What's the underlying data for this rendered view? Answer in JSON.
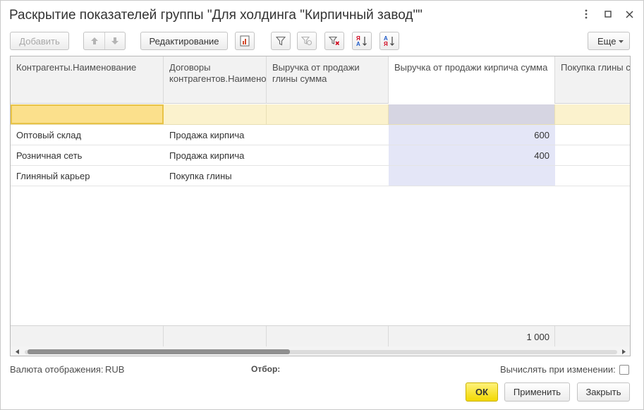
{
  "window": {
    "title": "Раскрытие показателей группы \"Для холдинга \"Кирпичный завод\"\""
  },
  "toolbar": {
    "add_label": "Добавить",
    "edit_label": "Редактирование",
    "more_label": "Еще"
  },
  "table": {
    "columns": [
      "Контрагенты.Наименование",
      "Договоры контрагентов.Наименование",
      "Выручка от продажи глины сумма",
      "Выручка от продажи кирпича сумма",
      "Покупка глины сумма"
    ],
    "rows": [
      {
        "c1": "Оптовый склад",
        "c2": "Продажа кирпича",
        "c3": "",
        "c4": "600",
        "c5": ""
      },
      {
        "c1": "Розничная сеть",
        "c2": "Продажа кирпича",
        "c3": "",
        "c4": "400",
        "c5": ""
      },
      {
        "c1": "Глиняный карьер",
        "c2": "Покупка глины",
        "c3": "",
        "c4": "",
        "c5": ""
      }
    ],
    "totals": {
      "c4": "1 000"
    }
  },
  "bottom": {
    "currency_label": "Валюта отображения:",
    "currency_value": "RUB",
    "filter_label": "Отбор:",
    "recalc_label": "Вычислять при изменении:",
    "recalc_checked": false
  },
  "buttons": {
    "ok": "ОК",
    "apply": "Применить",
    "close": "Закрыть"
  },
  "colors": {
    "accent_yellow": "#f3d900",
    "filter_row": "#fbf2cd",
    "selected_cell": "#fbe08c",
    "numeric_column": "#e4e6f7"
  }
}
